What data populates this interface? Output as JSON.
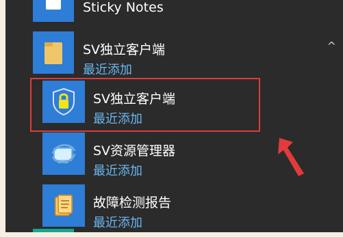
{
  "start_menu": {
    "items": [
      {
        "label": "Sticky Notes",
        "sub": ""
      },
      {
        "label": "SV独立客户端",
        "sub": "最近添加"
      },
      {
        "label": "SV独立客户端",
        "sub": "最近添加"
      },
      {
        "label": "SV资源管理器",
        "sub": "最近添加"
      },
      {
        "label": "故障检测报告",
        "sub": "最近添加"
      }
    ]
  },
  "icons": {
    "sticky_notes": "sticky-notes-icon",
    "folder": "folder-icon",
    "shield_lock": "shield-lock-icon",
    "explorer": "explorer-icon",
    "report": "report-icon",
    "chevron": "chevron-up-icon",
    "arrow": "red-arrow-icon"
  },
  "colors": {
    "background": "#2b2b2b",
    "tile": "#2e7dd6",
    "sub_text": "#6ab7f2",
    "highlight": "#e23b3b"
  },
  "ui": {
    "chevron_glyph": "^"
  }
}
